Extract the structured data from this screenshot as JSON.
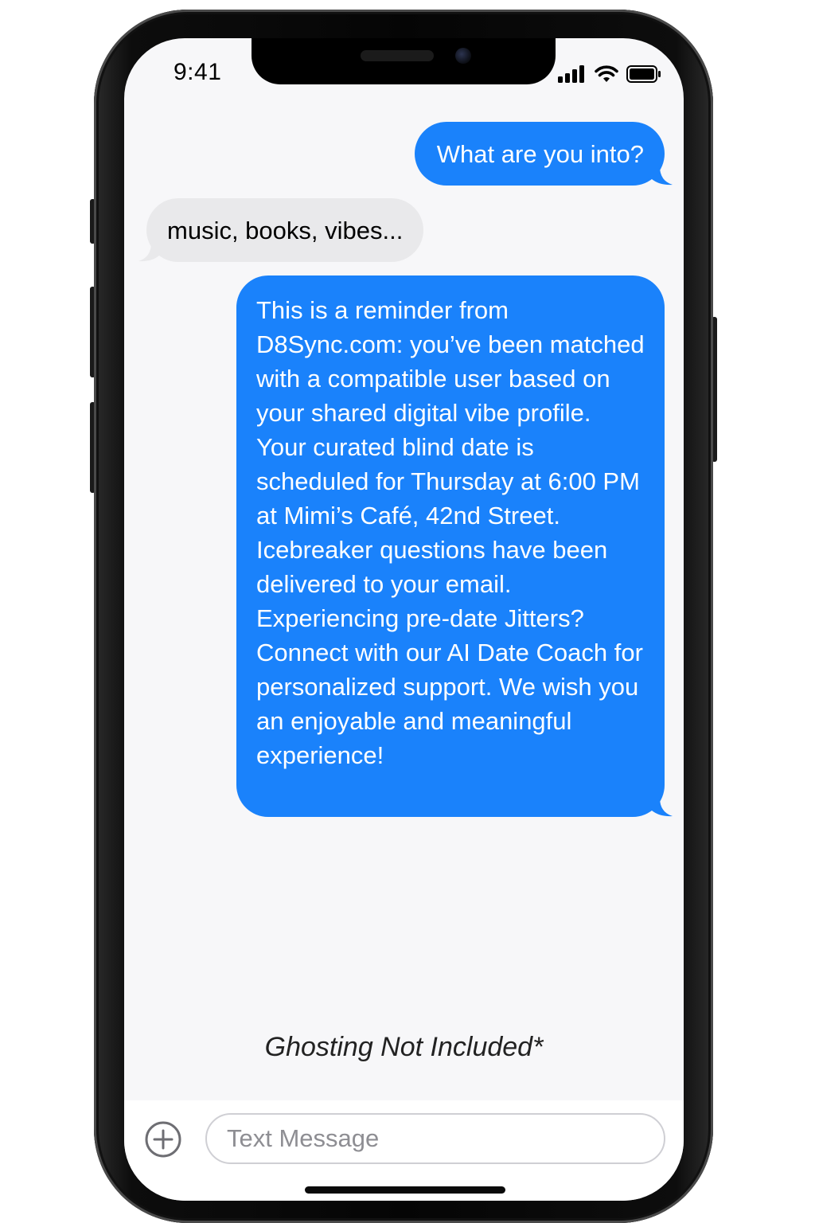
{
  "status_bar": {
    "time": "9:41",
    "icons": [
      "cellular-signal-icon",
      "wifi-icon",
      "battery-icon"
    ]
  },
  "colors": {
    "sent_bubble": "#1a82fb",
    "received_bubble": "#e9e9eb",
    "screen_background": "#f7f7f9"
  },
  "conversation": {
    "messages": [
      {
        "direction": "sent",
        "text": "What are you into?"
      },
      {
        "direction": "received",
        "text": "music, books, vibes..."
      },
      {
        "direction": "sent",
        "text": "This is a reminder from D8Sync.com: you’ve been matched with a compatible user based on your shared digital vibe profile. Your curated blind date is scheduled for Thursday at 6:00 PM at Mimi’s Café, 42nd Street. Icebreaker questions have been delivered to your email. Experiencing pre-date Jitters? Connect with our AI Date Coach for personalized support. We wish you an enjoyable and meaningful experience!"
      }
    ]
  },
  "caption": "Ghosting Not Included*",
  "composer": {
    "placeholder": "Text Message",
    "add_icon": "plus-circle-icon"
  }
}
